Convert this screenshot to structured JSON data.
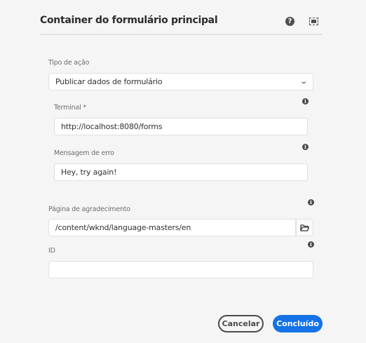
{
  "dialog": {
    "title": "Container do formulário principal",
    "help_icon": "help-icon",
    "fullscreen_icon": "fullscreen-icon"
  },
  "action_type": {
    "label": "Tipo de ação",
    "value": "Publicar dados de formulário"
  },
  "endpoint": {
    "label": "Terminal *",
    "value": "http://localhost:8080/forms"
  },
  "error_message": {
    "label": "Mensagem de erro",
    "value": "Hey, try again!"
  },
  "thank_you_page": {
    "label": "Página de agradecimento",
    "value": "/content/wknd/language-masters/en"
  },
  "id": {
    "label": "ID",
    "value": ""
  },
  "buttons": {
    "cancel": "Cancelar",
    "done": "Concluído"
  },
  "colors": {
    "primary": "#1473e6"
  }
}
